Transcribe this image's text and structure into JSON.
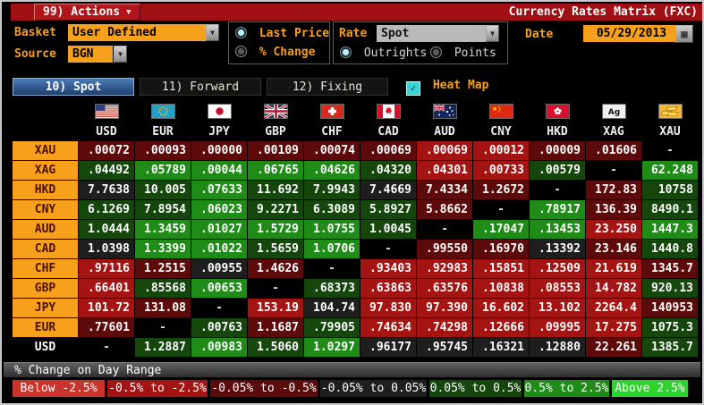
{
  "titlebar": {
    "actions_label": "99) Actions",
    "title": "Currency Rates Matrix (FXC)"
  },
  "controls": {
    "basket_label": "Basket",
    "basket_value": "User Defined",
    "source_label": "Source",
    "source_value": "BGN",
    "price_options": [
      {
        "label": "Last Price",
        "selected": true
      },
      {
        "label": "% Change",
        "selected": false
      }
    ],
    "rate_label": "Rate",
    "rate_value": "Spot",
    "rate_options": [
      {
        "label": "Outrights",
        "selected": true
      },
      {
        "label": "Points",
        "selected": false
      }
    ],
    "date_label": "Date",
    "date_value": "05/29/2013"
  },
  "tabs": [
    {
      "label": "10) Spot",
      "active": true
    },
    {
      "label": "11) Forward",
      "active": false
    },
    {
      "label": "12) Fixing",
      "active": false
    }
  ],
  "heatmap_checkbox": {
    "label": "Heat Map",
    "checked": true,
    "check_glyph": "✓"
  },
  "matrix": {
    "columns": [
      "USD",
      "EUR",
      "JPY",
      "GBP",
      "CHF",
      "CAD",
      "AUD",
      "CNY",
      "HKD",
      "XAG",
      "XAU"
    ],
    "rows": [
      {
        "label": "XAU",
        "label_style": "amber",
        "cells": [
          {
            "v": ".00072",
            "c": "r1"
          },
          {
            "v": ".00093",
            "c": "r1"
          },
          {
            "v": ".00000",
            "c": "r1"
          },
          {
            "v": ".00109",
            "c": "r1"
          },
          {
            "v": ".00074",
            "c": "r1"
          },
          {
            "v": ".00069",
            "c": "r1"
          },
          {
            "v": ".00069",
            "c": "r2"
          },
          {
            "v": ".00012",
            "c": "r2"
          },
          {
            "v": ".00009",
            "c": "r1"
          },
          {
            "v": ".01606",
            "c": "r1"
          },
          {
            "v": "-",
            "c": "d"
          }
        ]
      },
      {
        "label": "XAG",
        "label_style": "amber",
        "cells": [
          {
            "v": ".04492",
            "c": "g1"
          },
          {
            "v": ".05789",
            "c": "g2"
          },
          {
            "v": ".00044",
            "c": "g2"
          },
          {
            "v": ".06765",
            "c": "g2"
          },
          {
            "v": ".04626",
            "c": "g2"
          },
          {
            "v": ".04320",
            "c": "g1"
          },
          {
            "v": ".04301",
            "c": "r2"
          },
          {
            "v": ".00733",
            "c": "r2"
          },
          {
            "v": ".00579",
            "c": "g1"
          },
          {
            "v": "-",
            "c": "d"
          },
          {
            "v": "62.248",
            "c": "g2"
          }
        ]
      },
      {
        "label": "HKD",
        "label_style": "amber",
        "cells": [
          {
            "v": "7.7638",
            "c": "n"
          },
          {
            "v": "10.005",
            "c": "g1"
          },
          {
            "v": ".07633",
            "c": "g2"
          },
          {
            "v": "11.692",
            "c": "g1"
          },
          {
            "v": "7.9943",
            "c": "g1"
          },
          {
            "v": "7.4669",
            "c": "n"
          },
          {
            "v": "7.4334",
            "c": "r1"
          },
          {
            "v": "1.2672",
            "c": "r1"
          },
          {
            "v": "-",
            "c": "d"
          },
          {
            "v": "172.83",
            "c": "r1"
          },
          {
            "v": "10758",
            "c": "g1"
          }
        ]
      },
      {
        "label": "CNY",
        "label_style": "amber",
        "cells": [
          {
            "v": "6.1269",
            "c": "g1"
          },
          {
            "v": "7.8954",
            "c": "g1"
          },
          {
            "v": ".06023",
            "c": "g2"
          },
          {
            "v": "9.2271",
            "c": "g1"
          },
          {
            "v": "6.3089",
            "c": "g1"
          },
          {
            "v": "5.8927",
            "c": "g1"
          },
          {
            "v": "5.8662",
            "c": "r1"
          },
          {
            "v": "-",
            "c": "d"
          },
          {
            "v": ".78917",
            "c": "g2"
          },
          {
            "v": "136.39",
            "c": "r1"
          },
          {
            "v": "8490.1",
            "c": "g1"
          }
        ]
      },
      {
        "label": "AUD",
        "label_style": "amber",
        "cells": [
          {
            "v": "1.0444",
            "c": "g1"
          },
          {
            "v": "1.3459",
            "c": "g2"
          },
          {
            "v": ".01027",
            "c": "g2"
          },
          {
            "v": "1.5729",
            "c": "g2"
          },
          {
            "v": "1.0755",
            "c": "g2"
          },
          {
            "v": "1.0045",
            "c": "g1"
          },
          {
            "v": "-",
            "c": "d"
          },
          {
            "v": ".17047",
            "c": "g2"
          },
          {
            "v": ".13453",
            "c": "g2"
          },
          {
            "v": "23.250",
            "c": "r2"
          },
          {
            "v": "1447.3",
            "c": "g2"
          }
        ]
      },
      {
        "label": "CAD",
        "label_style": "amber",
        "cells": [
          {
            "v": "1.0398",
            "c": "n"
          },
          {
            "v": "1.3399",
            "c": "g2"
          },
          {
            "v": ".01022",
            "c": "g2"
          },
          {
            "v": "1.5659",
            "c": "g1"
          },
          {
            "v": "1.0706",
            "c": "g2"
          },
          {
            "v": "-",
            "c": "d"
          },
          {
            "v": ".99550",
            "c": "r1"
          },
          {
            "v": ".16970",
            "c": "r1"
          },
          {
            "v": ".13392",
            "c": "n"
          },
          {
            "v": "23.146",
            "c": "r1"
          },
          {
            "v": "1440.8",
            "c": "g1"
          }
        ]
      },
      {
        "label": "CHF",
        "label_style": "amber",
        "cells": [
          {
            "v": ".97116",
            "c": "r2"
          },
          {
            "v": "1.2515",
            "c": "r1"
          },
          {
            "v": ".00955",
            "c": "n"
          },
          {
            "v": "1.4626",
            "c": "r1"
          },
          {
            "v": "-",
            "c": "d"
          },
          {
            "v": ".93403",
            "c": "r2"
          },
          {
            "v": ".92983",
            "c": "r2"
          },
          {
            "v": ".15851",
            "c": "r2"
          },
          {
            "v": ".12509",
            "c": "r2"
          },
          {
            "v": "21.619",
            "c": "r2"
          },
          {
            "v": "1345.7",
            "c": "r1"
          }
        ]
      },
      {
        "label": "GBP",
        "label_style": "amber",
        "cells": [
          {
            "v": ".66401",
            "c": "r2"
          },
          {
            "v": ".85568",
            "c": "g1"
          },
          {
            "v": ".00653",
            "c": "g2"
          },
          {
            "v": "-",
            "c": "d"
          },
          {
            "v": ".68373",
            "c": "g1"
          },
          {
            "v": ".63863",
            "c": "r2"
          },
          {
            "v": ".63576",
            "c": "r2"
          },
          {
            "v": ".10838",
            "c": "r2"
          },
          {
            "v": ".08553",
            "c": "r2"
          },
          {
            "v": "14.782",
            "c": "r2"
          },
          {
            "v": "920.13",
            "c": "g1"
          }
        ]
      },
      {
        "label": "JPY",
        "label_style": "amber",
        "cells": [
          {
            "v": "101.72",
            "c": "r2"
          },
          {
            "v": "131.08",
            "c": "r1"
          },
          {
            "v": "-",
            "c": "d"
          },
          {
            "v": "153.19",
            "c": "r2"
          },
          {
            "v": "104.74",
            "c": "n"
          },
          {
            "v": "97.830",
            "c": "r2"
          },
          {
            "v": "97.390",
            "c": "r2"
          },
          {
            "v": "16.602",
            "c": "r2"
          },
          {
            "v": "13.102",
            "c": "r2"
          },
          {
            "v": "2264.4",
            "c": "r2"
          },
          {
            "v": "140953",
            "c": "r1"
          }
        ]
      },
      {
        "label": "EUR",
        "label_style": "amber",
        "cells": [
          {
            "v": ".77601",
            "c": "r1"
          },
          {
            "v": "-",
            "c": "d"
          },
          {
            "v": ".00763",
            "c": "g1"
          },
          {
            "v": "1.1687",
            "c": "r1"
          },
          {
            "v": ".79905",
            "c": "g1"
          },
          {
            "v": ".74634",
            "c": "r2"
          },
          {
            "v": ".74298",
            "c": "r2"
          },
          {
            "v": ".12666",
            "c": "r2"
          },
          {
            "v": ".09995",
            "c": "r2"
          },
          {
            "v": "17.275",
            "c": "r2"
          },
          {
            "v": "1075.3",
            "c": "g1"
          }
        ]
      },
      {
        "label": "USD",
        "label_style": "plain",
        "cells": [
          {
            "v": "-",
            "c": "d"
          },
          {
            "v": "1.2887",
            "c": "g1"
          },
          {
            "v": ".00983",
            "c": "g2"
          },
          {
            "v": "1.5060",
            "c": "g1"
          },
          {
            "v": "1.0297",
            "c": "g2"
          },
          {
            "v": ".96177",
            "c": "n"
          },
          {
            "v": ".95745",
            "c": "n"
          },
          {
            "v": ".16321",
            "c": "n"
          },
          {
            "v": ".12880",
            "c": "n"
          },
          {
            "v": "22.261",
            "c": "r1"
          },
          {
            "v": "1385.7",
            "c": "g1"
          }
        ]
      }
    ]
  },
  "legend": {
    "title": "% Change on Day Range",
    "items": [
      {
        "label": "Below -2.5%",
        "color_key": "r3"
      },
      {
        "label": "-0.5% to -2.5%",
        "color_key": "r2"
      },
      {
        "label": "-0.05% to -0.5%",
        "color_key": "r1"
      },
      {
        "label": "-0.05% to 0.05%",
        "color_key": "n"
      },
      {
        "label": "0.05% to 0.5%",
        "color_key": "g1"
      },
      {
        "label": "0.5% to 2.5%",
        "color_key": "g2"
      },
      {
        "label": "Above 2.5%",
        "color_key": "g3"
      }
    ]
  },
  "colors": {
    "amber": "#f6a01b",
    "redbar": "#a01014",
    "teal": "#3ad2d8",
    "tab_active_blue": "#2e5a96",
    "heat": {
      "r3": "#cb342b",
      "r2": "#a31412",
      "r1": "#5c0b0a",
      "n": "#1e1e1e",
      "g1": "#15470d",
      "g2": "#1e8c16",
      "g3": "#2fd32f"
    }
  }
}
